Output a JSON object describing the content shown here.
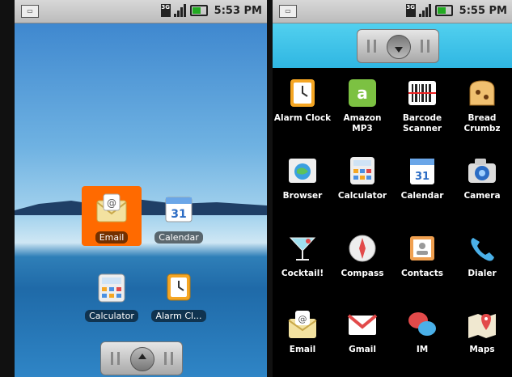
{
  "left": {
    "status_time": "5:53 PM",
    "status_network": "3G",
    "home_icons": [
      {
        "label": "Email"
      },
      {
        "label": "Calendar"
      },
      {
        "label": "Calculator"
      },
      {
        "label": "Alarm Cl..."
      }
    ]
  },
  "right": {
    "status_time": "5:55 PM",
    "apps": [
      {
        "label": "Alarm Clock"
      },
      {
        "label": "Amazon MP3"
      },
      {
        "label": "Barcode Scanner"
      },
      {
        "label": "Bread Crumbz"
      },
      {
        "label": "Browser"
      },
      {
        "label": "Calculator"
      },
      {
        "label": "Calendar"
      },
      {
        "label": "Camera"
      },
      {
        "label": "Cocktail!"
      },
      {
        "label": "Compass"
      },
      {
        "label": "Contacts"
      },
      {
        "label": "Dialer"
      },
      {
        "label": "Email"
      },
      {
        "label": "Gmail"
      },
      {
        "label": "IM"
      },
      {
        "label": "Maps"
      }
    ]
  },
  "calendar_day": "31",
  "colors": {
    "selection": "#ff6a00",
    "drawer_top": "#3cc2e8",
    "battery": "#22aa22"
  }
}
